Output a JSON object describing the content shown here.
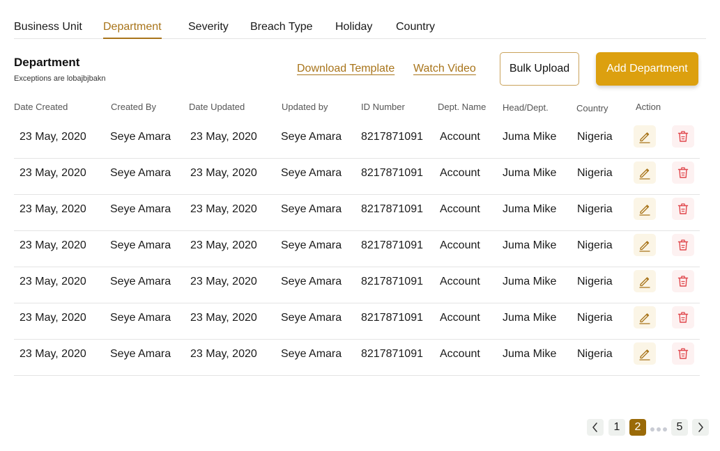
{
  "tabs": [
    "Business Unit",
    "Department",
    "Severity",
    "Breach Type",
    "Holiday",
    "Country"
  ],
  "active_tab": "Department",
  "header": {
    "title": "Department",
    "subtitle": "Exceptions are lobajbjbakn",
    "download_template": "Download Template",
    "watch_video": "Watch Video",
    "bulk_upload": "Bulk Upload",
    "add_department": "Add Department"
  },
  "table": {
    "columns": [
      "Date Created",
      "Created By",
      "Date Updated",
      "Updated by",
      "ID Number",
      "Dept. Name",
      "Head/Dept.",
      "Country",
      "Action"
    ],
    "rows": [
      [
        "23 May, 2020",
        "Seye Amara",
        "23 May, 2020",
        "Seye Amara",
        "8217871091",
        "Account",
        "Juma Mike",
        "Nigeria"
      ],
      [
        "23 May, 2020",
        "Seye Amara",
        "23 May, 2020",
        "Seye Amara",
        "8217871091",
        "Account",
        "Juma Mike",
        "Nigeria"
      ],
      [
        "23 May, 2020",
        "Seye Amara",
        "23 May, 2020",
        "Seye Amara",
        "8217871091",
        "Account",
        "Juma Mike",
        "Nigeria"
      ],
      [
        "23 May, 2020",
        "Seye Amara",
        "23 May, 2020",
        "Seye Amara",
        "8217871091",
        "Account",
        "Juma Mike",
        "Nigeria"
      ],
      [
        "23 May, 2020",
        "Seye Amara",
        "23 May, 2020",
        "Seye Amara",
        "8217871091",
        "Account",
        "Juma Mike",
        "Nigeria"
      ],
      [
        "23 May, 2020",
        "Seye Amara",
        "23 May, 2020",
        "Seye Amara",
        "8217871091",
        "Account",
        "Juma Mike",
        "Nigeria"
      ],
      [
        "23 May, 2020",
        "Seye Amara",
        "23 May, 2020",
        "Seye Amara",
        "8217871091",
        "Account",
        "Juma Mike",
        "Nigeria"
      ]
    ],
    "row_actions": [
      "pencil-icon",
      "trash-icon"
    ]
  },
  "pagination": {
    "pages": [
      "1",
      "2",
      "5"
    ],
    "current": "2",
    "prev_icon": "chevron-left-icon",
    "next_icon": "chevron-right-icon"
  },
  "colors": {
    "accent": "#a8741a",
    "primary_button": "#dca00f",
    "active_page": "#9a6a08",
    "delete": "#e0474c"
  }
}
